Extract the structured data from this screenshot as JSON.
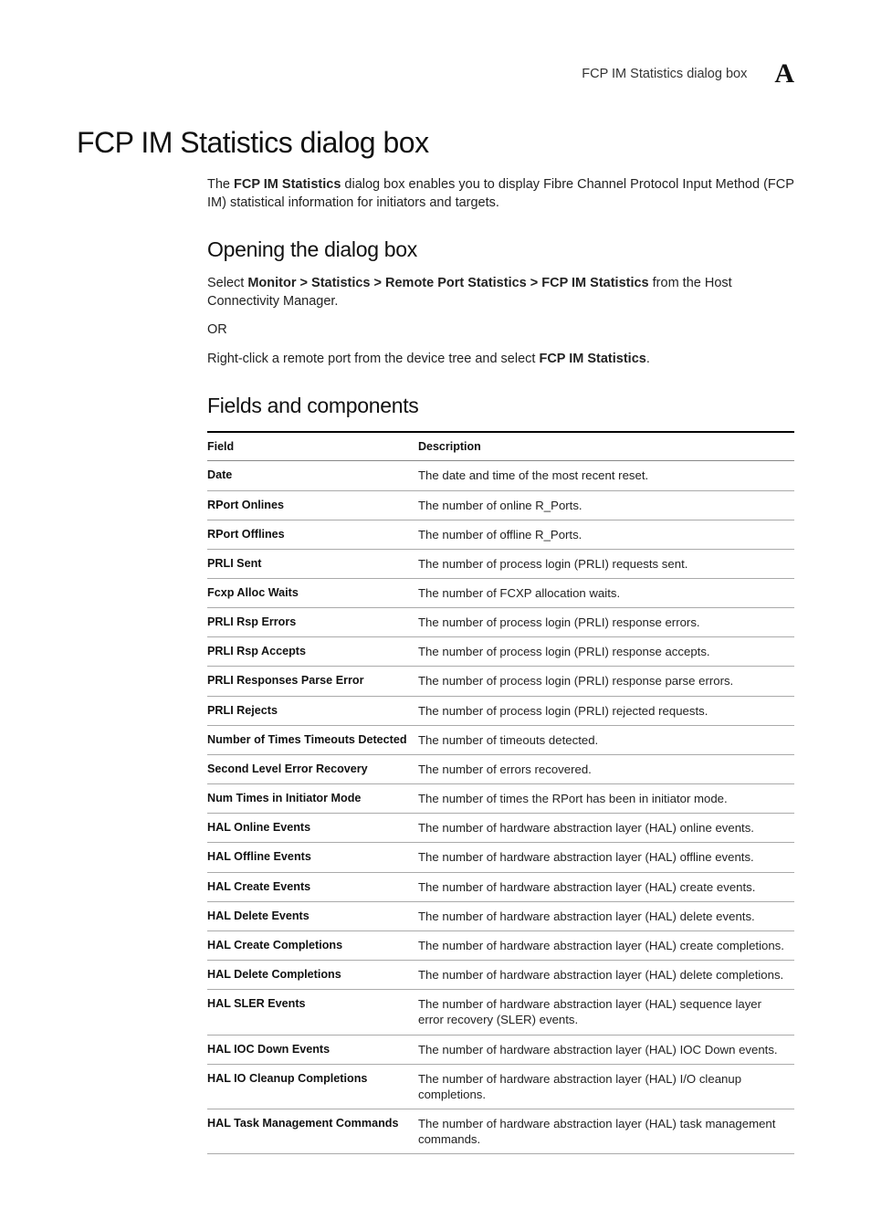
{
  "running_head": {
    "text": "FCP IM Statistics dialog box",
    "letter": "A"
  },
  "title": "FCP IM Statistics dialog box",
  "intro": {
    "prefix": "The ",
    "bold": "FCP IM Statistics",
    "suffix": " dialog box enables you to display Fibre Channel Protocol Input Method (FCP IM) statistical information for initiators and targets."
  },
  "opening": {
    "heading": "Opening the dialog box",
    "select_prefix": "Select ",
    "select_bold": "Monitor > Statistics > Remote Port Statistics > FCP IM Statistics",
    "select_suffix": " from the Host Connectivity Manager.",
    "or": "OR",
    "rc_prefix": "Right-click a remote port from the device tree and select ",
    "rc_bold": "FCP IM Statistics",
    "rc_suffix": "."
  },
  "fields": {
    "heading": "Fields and components",
    "col_field": "Field",
    "col_desc": "Description",
    "rows": [
      {
        "field": "Date",
        "desc": "The date and time of the most recent reset."
      },
      {
        "field": "RPort Onlines",
        "desc": "The number of online R_Ports."
      },
      {
        "field": "RPort Offlines",
        "desc": "The number of offline R_Ports."
      },
      {
        "field": "PRLI Sent",
        "desc": "The number of process login (PRLI) requests sent."
      },
      {
        "field": "Fcxp Alloc Waits",
        "desc": "The number of FCXP allocation waits."
      },
      {
        "field": "PRLI Rsp Errors",
        "desc": "The number of process login (PRLI) response errors."
      },
      {
        "field": "PRLI Rsp Accepts",
        "desc": "The number of process login (PRLI) response accepts."
      },
      {
        "field": "PRLI Responses Parse Error",
        "desc": "The number of process login (PRLI) response parse errors."
      },
      {
        "field": "PRLI Rejects",
        "desc": "The number of process login (PRLI) rejected requests."
      },
      {
        "field": "Number of Times Timeouts Detected",
        "desc": "The number of timeouts detected."
      },
      {
        "field": "Second Level Error Recovery",
        "desc": "The number of errors recovered."
      },
      {
        "field": "Num Times in Initiator Mode",
        "desc": "The number of times the RPort has been in initiator mode."
      },
      {
        "field": "HAL Online Events",
        "desc": "The number of hardware abstraction layer (HAL) online events."
      },
      {
        "field": "HAL Offline Events",
        "desc": "The number of hardware abstraction layer (HAL) offline events."
      },
      {
        "field": "HAL Create Events",
        "desc": "The number of hardware abstraction layer (HAL) create events."
      },
      {
        "field": "HAL Delete Events",
        "desc": "The number of hardware abstraction layer (HAL) delete events."
      },
      {
        "field": "HAL Create Completions",
        "desc": "The number of hardware abstraction layer (HAL) create completions."
      },
      {
        "field": "HAL Delete Completions",
        "desc": "The number of hardware abstraction layer (HAL) delete completions."
      },
      {
        "field": "HAL SLER Events",
        "desc": "The number of hardware abstraction layer (HAL) sequence layer error recovery (SLER) events."
      },
      {
        "field": "HAL IOC Down Events",
        "desc": "The number of hardware abstraction layer (HAL) IOC Down events."
      },
      {
        "field": "HAL IO Cleanup Completions",
        "desc": "The number of hardware abstraction layer (HAL) I/O cleanup completions."
      },
      {
        "field": "HAL Task Management Commands",
        "desc": "The number of hardware abstraction layer (HAL) task management commands."
      }
    ]
  }
}
